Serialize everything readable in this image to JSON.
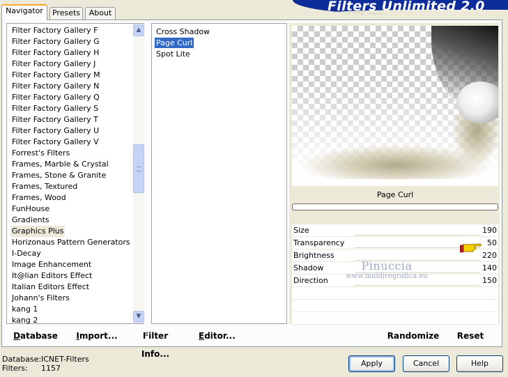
{
  "tabs": [
    {
      "label": "Navigator",
      "active": true
    },
    {
      "label": "Presets",
      "active": false
    },
    {
      "label": "About",
      "active": false
    }
  ],
  "brand": {
    "title": "Filters Unlimited 2.0"
  },
  "categories": [
    "Filter Factory Gallery F",
    "Filter Factory Gallery G",
    "Filter Factory Gallery H",
    "Filter Factory Gallery J",
    "Filter Factory Gallery M",
    "Filter Factory Gallery N",
    "Filter Factory Gallery Q",
    "Filter Factory Gallery S",
    "Filter Factory Gallery T",
    "Filter Factory Gallery U",
    "Filter Factory Gallery V",
    "Forrest's Filters",
    "Frames, Marble & Crystal",
    "Frames, Stone & Granite",
    "Frames, Textured",
    "Frames, Wood",
    "FunHouse",
    "Gradients",
    "Graphics Plus",
    "Horizonaus Pattern Generators",
    "I-Decay",
    "Image Enhancement",
    "It@lian Editors Effect",
    "Italian Editors Effect",
    "Johann's Filters",
    "kang 1",
    "kang 2"
  ],
  "selected_category": "Graphics Plus",
  "filters": [
    "Cross Shadow",
    "Page Curl",
    "Spot Lite"
  ],
  "selected_filter": "Page Curl",
  "preview": {
    "label": "Page Curl"
  },
  "parameters": [
    {
      "name": "Size",
      "value": "190"
    },
    {
      "name": "Transparency",
      "value": "50"
    },
    {
      "name": "Brightness",
      "value": "220"
    },
    {
      "name": "Shadow",
      "value": "140"
    },
    {
      "name": "Direction",
      "value": "150"
    }
  ],
  "watermark": {
    "name": "Pinuccia",
    "site": "www.maidiregrafica.eu"
  },
  "toolbar": {
    "database": "Database",
    "import": "Import...",
    "filter_info": "Filter Info...",
    "editor": "Editor...",
    "randomize": "Randomize",
    "reset": "Reset"
  },
  "status": {
    "database_label": "Database:",
    "database_value": "ICNET-Filters",
    "filters_label": "Filters:",
    "filters_value": "1157"
  },
  "buttons": {
    "apply": "Apply",
    "cancel": "Cancel",
    "help": "Help"
  },
  "icons": {
    "scroll_up": "▲",
    "scroll_down": "▼"
  },
  "colors": {
    "selection": "#316ac5",
    "banner": "#0c2c9a",
    "dialog_bg": "#ece9d8"
  }
}
